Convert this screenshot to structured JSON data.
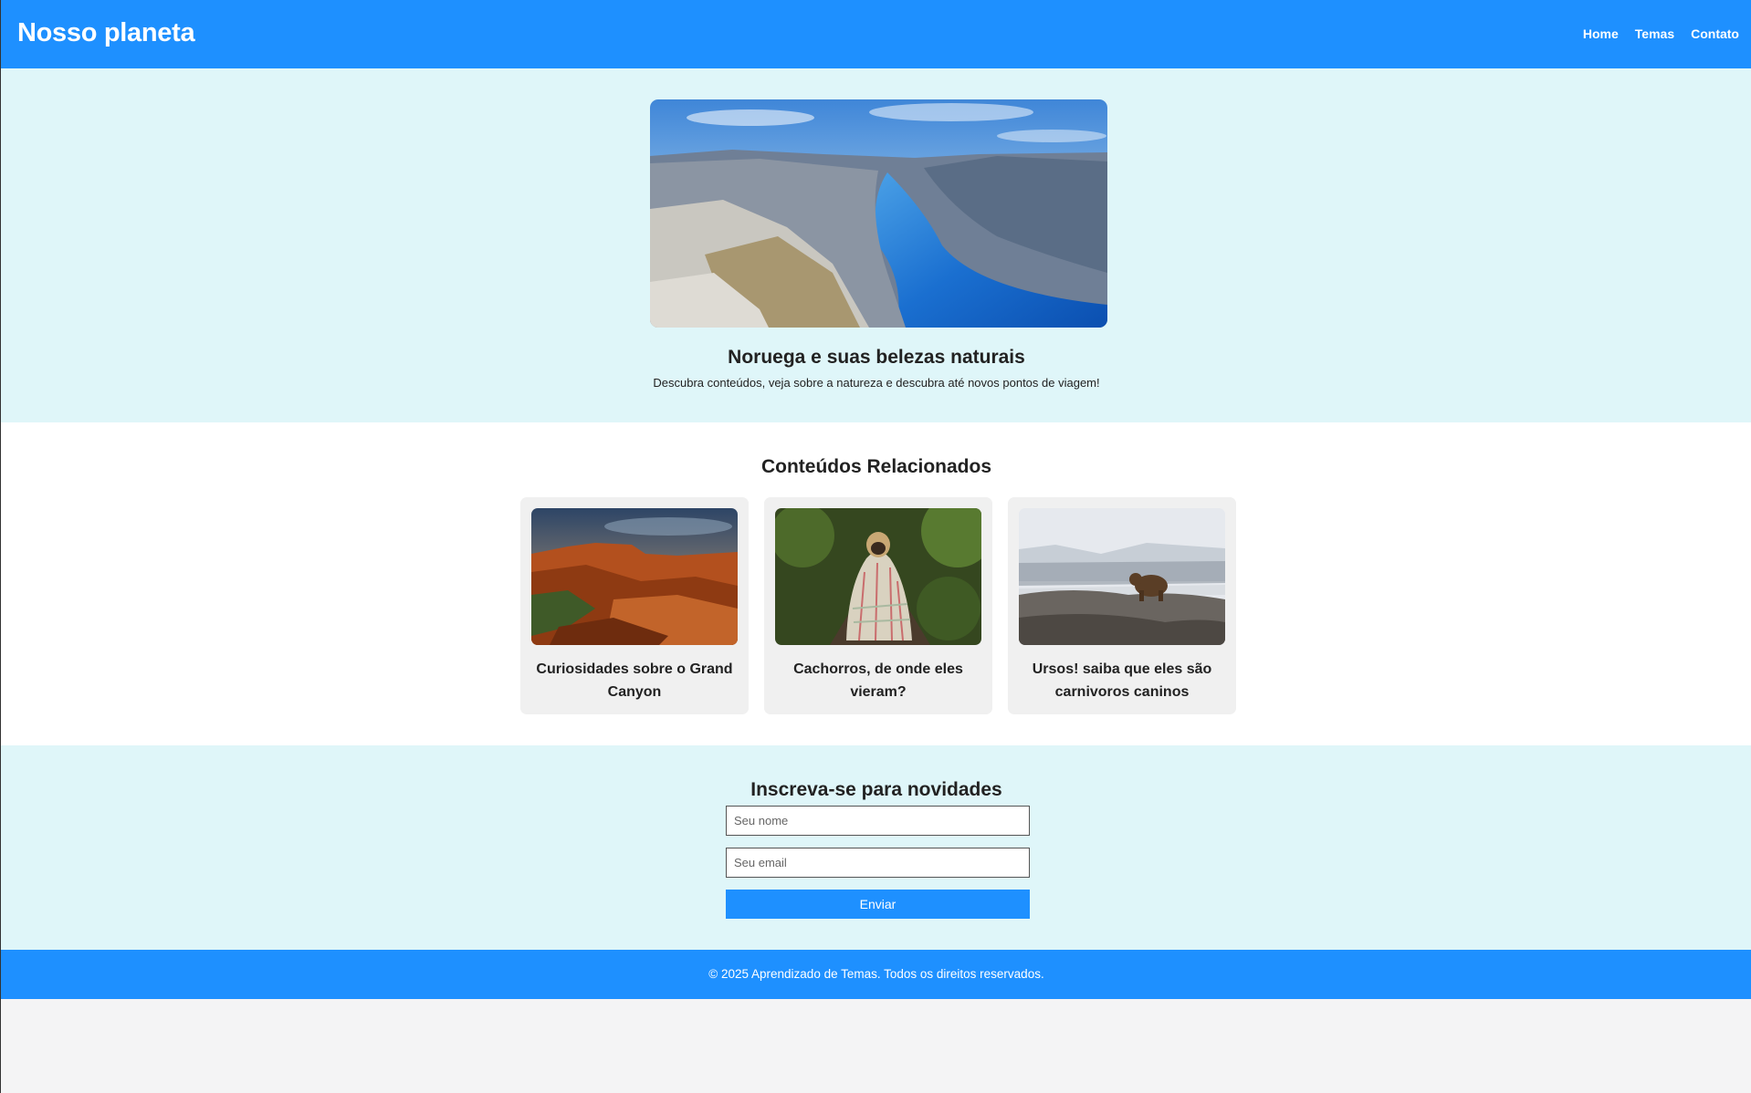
{
  "header": {
    "brand": "Nosso planeta",
    "nav": [
      "Home",
      "Temas",
      "Contato"
    ]
  },
  "hero": {
    "title": "Noruega e suas belezas naturais",
    "subtitle": "Descubra conteúdos, veja sobre a natureza e descubra até novos pontos de viagem!"
  },
  "related": {
    "title": "Conteúdos Relacionados",
    "cards": [
      {
        "title": "Curiosidades sobre o Grand Canyon"
      },
      {
        "title": "Cachorros, de onde eles vieram?"
      },
      {
        "title": "Ursos! saiba que eles são carnivoros caninos"
      }
    ]
  },
  "subscribe": {
    "title": "Inscreva-se para novidades",
    "name_placeholder": "Seu nome",
    "email_placeholder": "Seu email",
    "button": "Enviar"
  },
  "footer": {
    "copyright": "© 2025 Aprendizado de Temas. Todos os direitos reservados."
  },
  "colors": {
    "primary": "#1e90ff",
    "light_section": "#dff6f9",
    "card_bg": "#f0f0f0"
  }
}
